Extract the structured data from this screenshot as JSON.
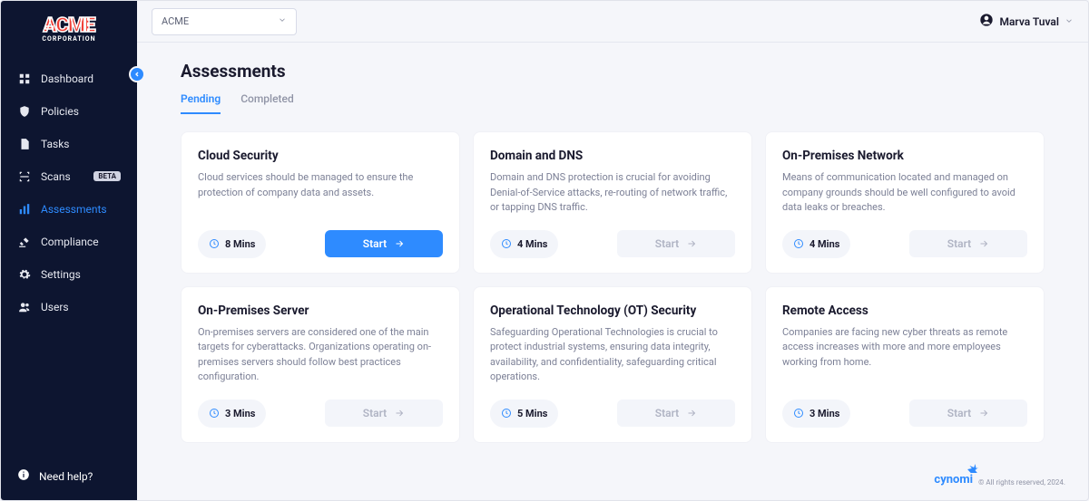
{
  "brand": {
    "name": "ACME",
    "subtitle": "CORPORATION"
  },
  "nav": {
    "dashboard": "Dashboard",
    "policies": "Policies",
    "tasks": "Tasks",
    "scans": "Scans",
    "scans_badge": "BETA",
    "assessments": "Assessments",
    "compliance": "Compliance",
    "settings": "Settings",
    "users": "Users"
  },
  "help": "Need help?",
  "org_selector": {
    "value": "ACME"
  },
  "user": {
    "name": "Marva Tuval"
  },
  "page": {
    "title": "Assessments"
  },
  "tabs": {
    "pending": "Pending",
    "completed": "Completed"
  },
  "action_labels": {
    "start": "Start"
  },
  "cards": [
    {
      "title": "Cloud Security",
      "desc": "Cloud services should be managed to ensure the protection of company data and assets.",
      "mins": "8 Mins",
      "primary": true
    },
    {
      "title": "Domain and DNS",
      "desc": "Domain and DNS protection is crucial for avoiding Denial-of-Service attacks, re-routing of network traffic, or tapping DNS traffic.",
      "mins": "4 Mins",
      "primary": false
    },
    {
      "title": "On-Premises Network",
      "desc": "Means of communication located and managed on company grounds should be well configured to avoid data leaks or breaches.",
      "mins": "4 Mins",
      "primary": false
    },
    {
      "title": "On-Premises Server",
      "desc": "On-premises servers are considered one of the main targets for cyberattacks. Organizations operating on-premises servers should follow best practices configuration.",
      "mins": "3 Mins",
      "primary": false
    },
    {
      "title": "Operational Technology (OT) Security",
      "desc": "Safeguarding Operational Technologies is crucial to protect industrial systems, ensuring data integrity, availability, and confidentiality, safeguarding critical operations.",
      "mins": "5 Mins",
      "primary": false
    },
    {
      "title": "Remote Access",
      "desc": "Companies are facing new cyber threats as remote access increases with more and more employees working from home.",
      "mins": "3 Mins",
      "primary": false
    }
  ],
  "footer": {
    "brand": "cynomi",
    "copy": "© All rights reserved, 2024."
  }
}
